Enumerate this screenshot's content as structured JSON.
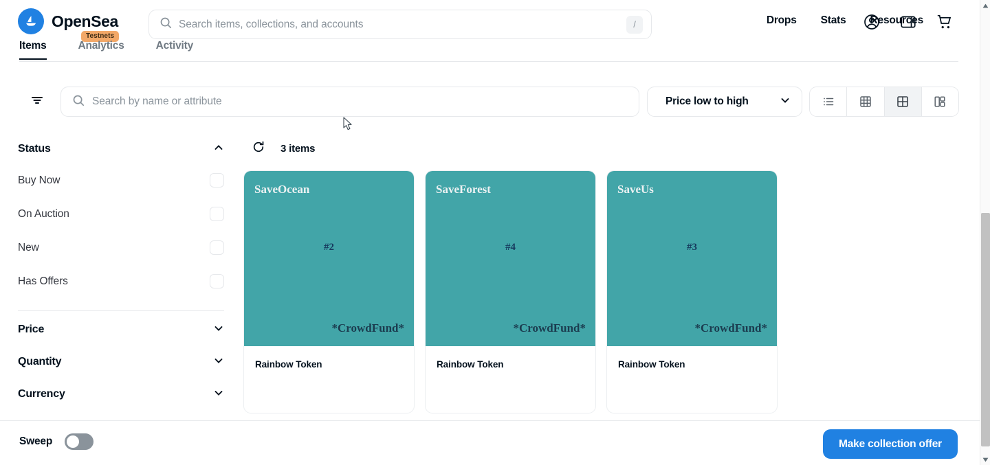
{
  "header": {
    "brand": "OpenSea",
    "badge": "Testnets",
    "logo_icon": "sailboat-logo-icon",
    "brand_color": "#2081E2",
    "badge_color": "#F2A868",
    "search": {
      "placeholder": "Search items, collections, and accounts",
      "value": "",
      "icon": "search-icon",
      "shortcut": "/"
    },
    "nav": [
      {
        "label": "Drops"
      },
      {
        "label": "Stats"
      },
      {
        "label": "Resources"
      }
    ],
    "icons": [
      {
        "name": "account-icon"
      },
      {
        "name": "wallet-icon"
      },
      {
        "name": "cart-icon"
      }
    ]
  },
  "tabs": [
    {
      "label": "Items",
      "active": true
    },
    {
      "label": "Analytics",
      "active": false
    },
    {
      "label": "Activity",
      "active": false
    }
  ],
  "toolbar": {
    "filter_icon": "filter-icon",
    "search": {
      "placeholder": "Search by name or attribute",
      "value": "",
      "icon": "search-icon"
    },
    "sort": {
      "value": "Price low to high",
      "chevron": "chevron-down-icon"
    },
    "views": [
      {
        "name": "list-view",
        "active": false
      },
      {
        "name": "grid-small-view",
        "active": false
      },
      {
        "name": "grid-large-view",
        "active": true
      },
      {
        "name": "mixed-view",
        "active": false
      }
    ]
  },
  "sidebar": {
    "sections": [
      {
        "title": "Status",
        "expanded": true,
        "chevron": "chevron-up-icon",
        "options": [
          {
            "label": "Buy Now",
            "checked": false
          },
          {
            "label": "On Auction",
            "checked": false
          },
          {
            "label": "New",
            "checked": false
          },
          {
            "label": "Has Offers",
            "checked": false
          }
        ]
      },
      {
        "title": "Price",
        "expanded": false,
        "chevron": "chevron-down-icon",
        "options": []
      },
      {
        "title": "Quantity",
        "expanded": false,
        "chevron": "chevron-down-icon",
        "options": []
      },
      {
        "title": "Currency",
        "expanded": false,
        "chevron": "chevron-down-icon",
        "options": []
      }
    ]
  },
  "items": {
    "refresh_icon": "refresh-icon",
    "count_label": "3 items",
    "art_color": "#42A5A8",
    "cards": [
      {
        "art_title": "SaveOcean",
        "art_number": "#2",
        "art_footer": "*CrowdFund*",
        "name": "Rainbow Token"
      },
      {
        "art_title": "SaveForest",
        "art_number": "#4",
        "art_footer": "*CrowdFund*",
        "name": "Rainbow Token"
      },
      {
        "art_title": "SaveUs",
        "art_number": "#3",
        "art_footer": "*CrowdFund*",
        "name": "Rainbow Token"
      }
    ]
  },
  "bottom_bar": {
    "sweep_label": "Sweep",
    "sweep_on": false,
    "cta_label": "Make collection offer",
    "cta_color": "#2081E2"
  }
}
